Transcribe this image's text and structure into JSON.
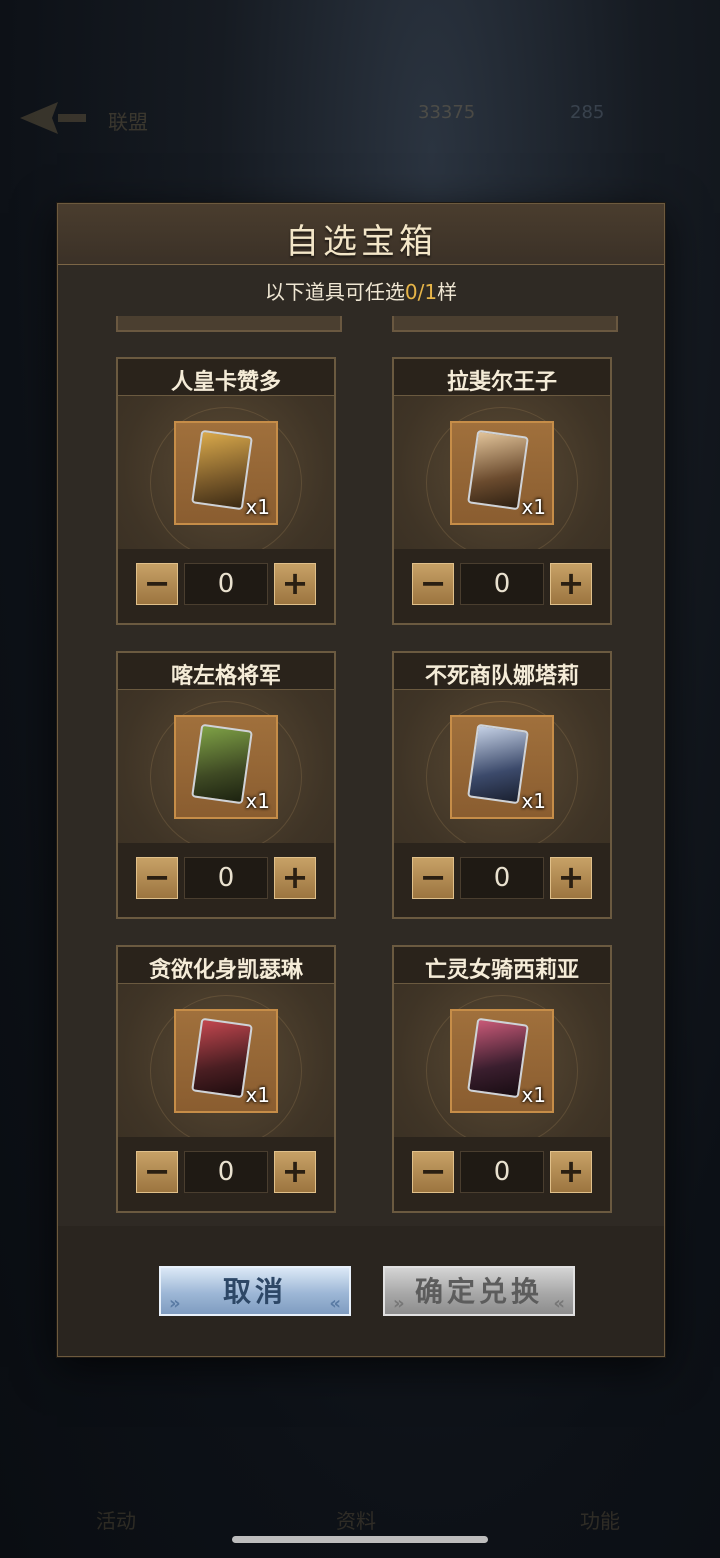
{
  "background": {
    "back_label": "联盟",
    "currency_1": "33375",
    "currency_2": "285",
    "nav_items": [
      "活动",
      "资料",
      "功能"
    ]
  },
  "modal": {
    "title": "自选宝箱",
    "subtitle_prefix": "以下道具可任选",
    "subtitle_count": "0/1",
    "subtitle_suffix": "样",
    "items": [
      {
        "name": "人皇卡赞多",
        "qty_badge": "x1",
        "quantity": "0",
        "portrait_colors": [
          "#7a5a2a",
          "#d9a94b"
        ]
      },
      {
        "name": "拉斐尔王子",
        "qty_badge": "x1",
        "quantity": "0",
        "portrait_colors": [
          "#6b4b2e",
          "#e2c49a"
        ]
      },
      {
        "name": "喀左格将军",
        "qty_badge": "x1",
        "quantity": "0",
        "portrait_colors": [
          "#3f4a24",
          "#7fa246"
        ]
      },
      {
        "name": "不死商队娜塔莉",
        "qty_badge": "x1",
        "quantity": "0",
        "portrait_colors": [
          "#3c4a6b",
          "#c6d2e6"
        ]
      },
      {
        "name": "贪欲化身凯瑟琳",
        "qty_badge": "x1",
        "quantity": "0",
        "portrait_colors": [
          "#4a1e22",
          "#c3474f"
        ]
      },
      {
        "name": "亡灵女骑西莉亚",
        "qty_badge": "x1",
        "quantity": "0",
        "portrait_colors": [
          "#3a1e2e",
          "#c95a78"
        ]
      }
    ],
    "minus_label": "−",
    "plus_label": "+",
    "cancel_label": "取消",
    "confirm_label": "确定兑换"
  },
  "colors": {
    "accent_gold": "#e7b548",
    "cancel_blue": "#9db7d6",
    "confirm_disabled_gray": "#a8a8a8"
  }
}
